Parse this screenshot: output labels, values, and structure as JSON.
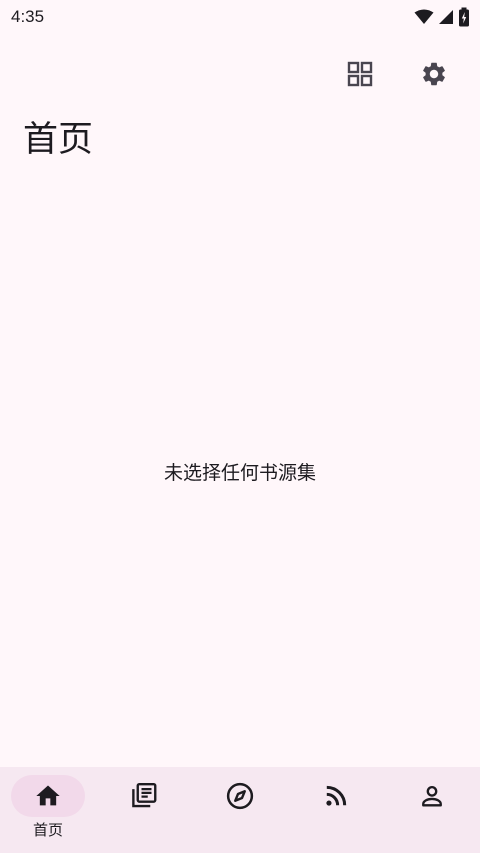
{
  "status_bar": {
    "time": "4:35",
    "icons": [
      "wifi-icon",
      "cell-signal-icon",
      "battery-charging-icon"
    ]
  },
  "toolbar": {
    "actions": [
      "grid-view-icon",
      "settings-gear-icon"
    ]
  },
  "page": {
    "title": "首页",
    "empty_message": "未选择任何书源集"
  },
  "bottom_nav": {
    "items": [
      {
        "icon": "home-icon",
        "label": "首页",
        "active": true
      },
      {
        "icon": "library-icon",
        "label": "",
        "active": false
      },
      {
        "icon": "compass-icon",
        "label": "",
        "active": false
      },
      {
        "icon": "rss-icon",
        "label": "",
        "active": false
      },
      {
        "icon": "person-icon",
        "label": "",
        "active": false
      }
    ]
  },
  "colors": {
    "background": "#FFF7FA",
    "nav_background": "#F6E8F1",
    "active_indicator": "#F2D9EA",
    "icon": "#49454F",
    "text": "#1D1B20"
  }
}
